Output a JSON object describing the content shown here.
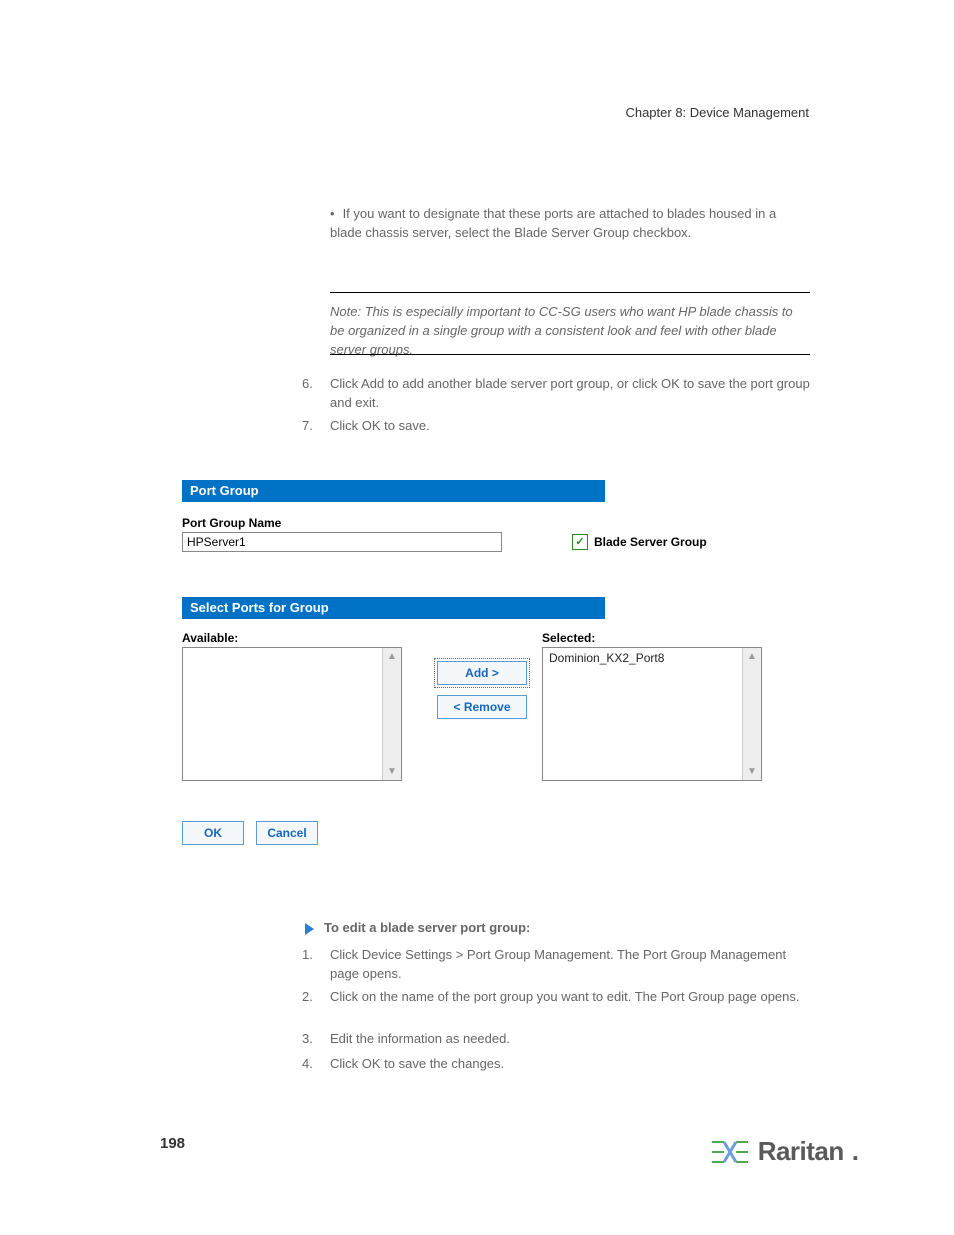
{
  "header": {
    "chapter": "Chapter 8: Device Management"
  },
  "footer": {
    "page_number": "198",
    "logo_text": "Raritan",
    "logo_dot": "."
  },
  "instructions": {
    "step5_pre": "If you want to designate that these ports are attached to blades housed in a blade chassis server, select the Blade Server Group checkbox.",
    "note_label": "Note:",
    "note_body": " This is especially important to CC-SG users who want HP blade chassis to be organized in a single group with a consistent look and feel with other blade server groups.",
    "step6_num": "6.",
    "step6": "Click Add to add another blade server port group, or click OK to save the port group and exit.",
    "step7_num": "7.",
    "step7": "Click OK to save.",
    "section_heading": "To edit a blade server port group:",
    "edit_step1_num": "1.",
    "edit_step1": "Click Device Settings > Port Group Management. The Port Group Management page opens.",
    "edit_step2_num": "2.",
    "edit_step2": "Click on the name of the port group you want to edit. The Port Group page opens.",
    "edit_step3_num": "3.",
    "edit_step3": "Edit the information as needed.",
    "edit_step4_num": "4.",
    "edit_step4": "Click OK to save the changes."
  },
  "ui": {
    "port_group_header": "Port Group",
    "port_group_name_label": "Port Group Name",
    "port_group_name_value": "HPServer1",
    "blade_checkbox_label": "Blade Server Group",
    "blade_checkbox_checked": true,
    "select_ports_header": "Select Ports for Group",
    "available_label": "Available:",
    "selected_label": "Selected:",
    "selected_item": "Dominion_KX2_Port8",
    "add_button": "Add >",
    "remove_button": "< Remove",
    "ok_button": "OK",
    "cancel_button": "Cancel"
  }
}
